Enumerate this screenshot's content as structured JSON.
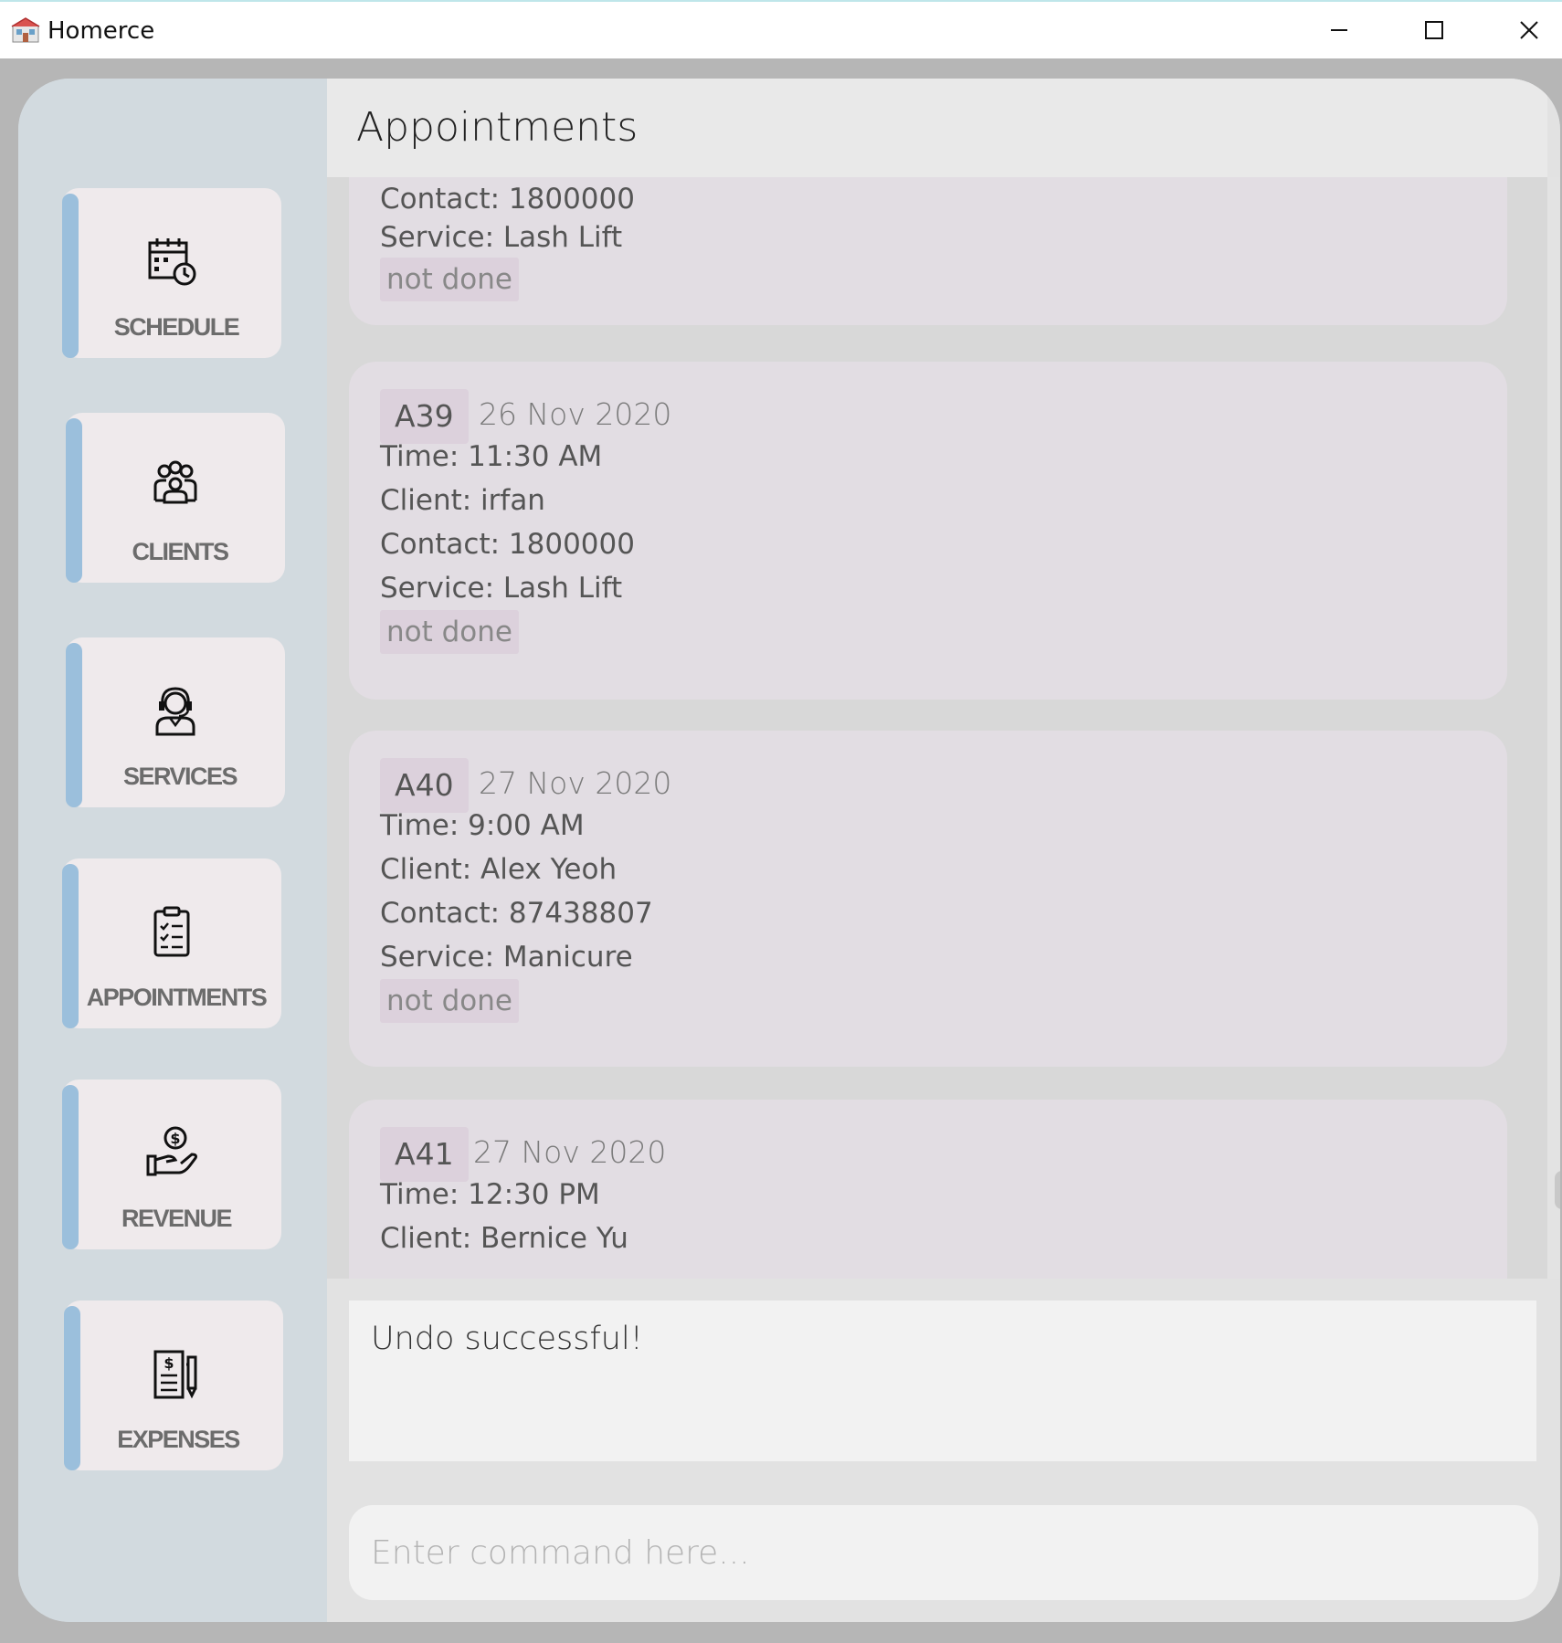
{
  "window": {
    "title": "Homerce",
    "controls": {
      "minimize": "minimize-icon",
      "maximize": "maximize-icon",
      "close": "close-icon"
    }
  },
  "sidebar": {
    "items": [
      {
        "label": "SCHEDULE",
        "icon": "calendar-clock-icon"
      },
      {
        "label": "CLIENTS",
        "icon": "people-group-icon"
      },
      {
        "label": "SERVICES",
        "icon": "headset-agent-icon"
      },
      {
        "label": "APPOINTMENTS",
        "icon": "clipboard-checklist-icon"
      },
      {
        "label": "REVENUE",
        "icon": "hand-coin-icon"
      },
      {
        "label": "EXPENSES",
        "icon": "receipt-pen-icon"
      }
    ]
  },
  "main": {
    "title": "Appointments",
    "appointments": [
      {
        "contact": "Contact: 1800000",
        "service": "Service: Lash Lift",
        "status": "not done"
      },
      {
        "id": "A39",
        "date": "26 Nov 2020",
        "time": "Time: 11:30 AM",
        "client": "Client: irfan",
        "contact": "Contact: 1800000",
        "service": "Service: Lash Lift",
        "status": "not done"
      },
      {
        "id": "A40",
        "date": "27 Nov 2020",
        "time": "Time: 9:00 AM",
        "client": "Client: Alex Yeoh",
        "contact": "Contact: 87438807",
        "service": "Service: Manicure",
        "status": "not done"
      },
      {
        "id": "A41",
        "date": "27 Nov 2020",
        "time": "Time: 12:30 PM",
        "client": "Client: Bernice Yu"
      }
    ],
    "result": "Undo successful!",
    "command": {
      "value": "",
      "placeholder": "Enter command here..."
    }
  },
  "colors": {
    "sidebar_bg": "#d2dadf",
    "nav_stripe": "#9bbfdc",
    "card_bg": "#e2dde3",
    "badge_bg": "#dcd1dc"
  }
}
